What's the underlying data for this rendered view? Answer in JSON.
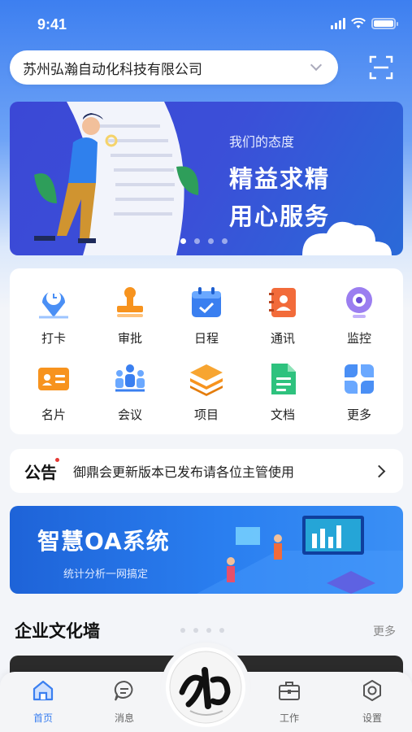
{
  "status_bar": {
    "time": "9:41"
  },
  "header": {
    "company_name": "苏州弘瀚自动化科技有限公司"
  },
  "banner": {
    "subtitle": "我们的态度",
    "line1": "精益求精",
    "line2": "用心服务",
    "active_slide": 1,
    "slides": 4
  },
  "apps": [
    {
      "label": "打卡",
      "icon": "location-clock-icon"
    },
    {
      "label": "审批",
      "icon": "stamp-icon"
    },
    {
      "label": "日程",
      "icon": "calendar-icon"
    },
    {
      "label": "通讯",
      "icon": "contacts-book-icon"
    },
    {
      "label": "监控",
      "icon": "webcam-icon"
    },
    {
      "label": "名片",
      "icon": "id-card-icon"
    },
    {
      "label": "会议",
      "icon": "meeting-icon"
    },
    {
      "label": "项目",
      "icon": "layers-icon"
    },
    {
      "label": "文档",
      "icon": "document-icon"
    },
    {
      "label": "更多",
      "icon": "more-grid-icon"
    }
  ],
  "notice": {
    "tag": "公告",
    "text": "御鼎会更新版本已发布请各位主管使用"
  },
  "oa_banner": {
    "title": "智慧OA系统",
    "subtitle": "统计分析一网搞定"
  },
  "culture": {
    "title": "企业文化墙",
    "more": "更多"
  },
  "tabbar": {
    "items": [
      {
        "label": "首页",
        "icon": "home-icon",
        "active": true
      },
      {
        "label": "消息",
        "icon": "message-icon",
        "active": false
      },
      {
        "label": "工作",
        "icon": "briefcase-icon",
        "active": false
      },
      {
        "label": "设置",
        "icon": "settings-icon",
        "active": false
      }
    ]
  },
  "colors": {
    "primary": "#3a7ff0",
    "orange": "#f7931e",
    "green": "#2ec27e",
    "purple": "#9b7ef0"
  }
}
